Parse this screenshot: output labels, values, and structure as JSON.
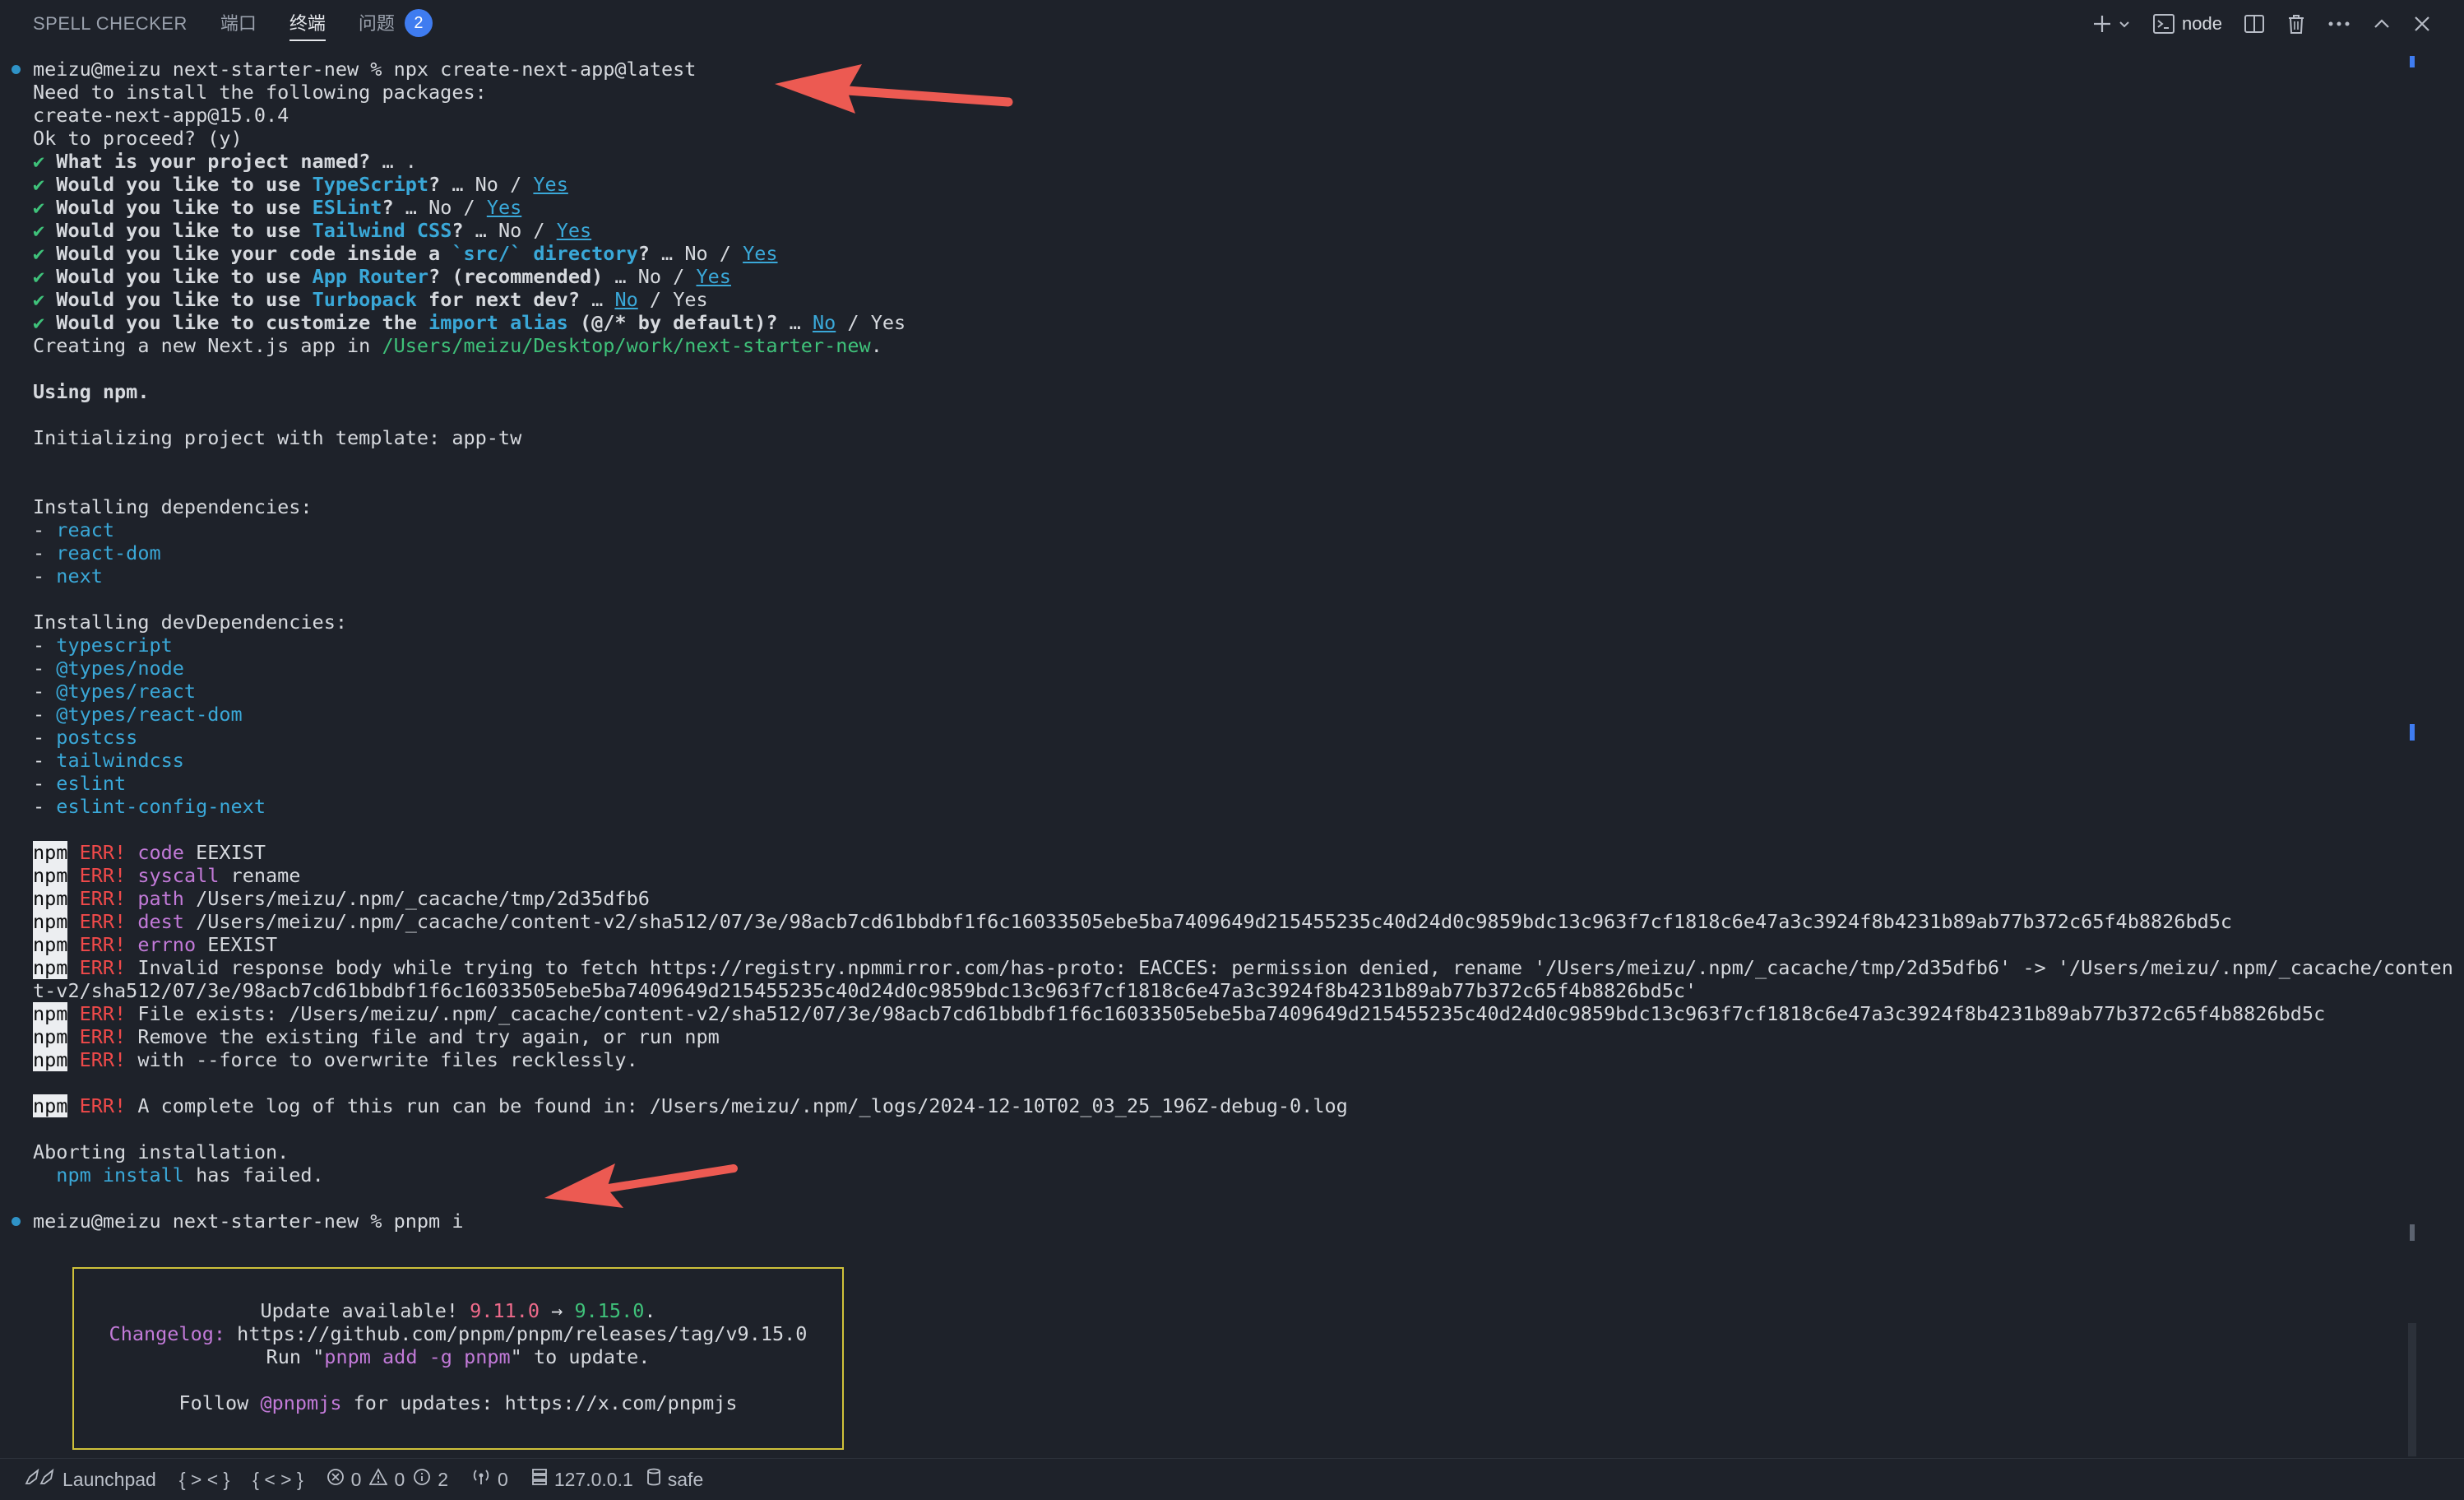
{
  "panel": {
    "tabs": [
      {
        "label": "SPELL CHECKER"
      },
      {
        "label": "端口"
      },
      {
        "label": "终端"
      },
      {
        "label": "问题"
      }
    ],
    "problems_count": "2",
    "terminal_name": "node"
  },
  "terminal": {
    "prompt1": "meizu@meizu next-starter-new % npx create-next-app@latest",
    "l_need": "Need to install the following packages:",
    "l_pkg": "create-next-app@15.0.4",
    "l_ok": "Ok to proceed? (y)",
    "q_name": "What is your project named?",
    "q_name_ans": " … .",
    "q_ts_a": "Would you like to use ",
    "q_ts_b": "TypeScript",
    "q_eslint_b": "ESLint",
    "q_tw_b": "Tailwind CSS",
    "q_src_a": "Would you like your code inside a ",
    "q_src_b": "`src/` directory",
    "q_router_b": "App Router",
    "q_router_c": "? (recommended)",
    "q_turbo_b": "Turbopack",
    "q_turbo_c": " for next dev?",
    "q_alias_a": "Would you like to customize the ",
    "q_alias_b": "import alias",
    "q_alias_c": " (@/* by default)?",
    "ans_sep": " … ",
    "no": "No",
    "slash": " / ",
    "yes": "Yes",
    "creating": "Creating a new Next.js app in ",
    "creating_path": "/Users/meizu/Desktop/work/next-starter-new",
    "using": "Using npm.",
    "init": "Initializing project with template: app-tw",
    "deps_header": "Installing dependencies:",
    "deps": [
      "react",
      "react-dom",
      "next"
    ],
    "devdeps_header": "Installing devDependencies:",
    "devdeps": [
      "typescript",
      "@types/node",
      "@types/react",
      "@types/react-dom",
      "postcss",
      "tailwindcss",
      "eslint",
      "eslint-config-next"
    ],
    "npm": "npm",
    "err": "ERR!",
    "e_code_k": "code",
    "e_code_v": " EEXIST",
    "e_sys_k": "syscall",
    "e_sys_v": " rename",
    "e_path_k": "path",
    "e_path_v": " /Users/meizu/.npm/_cacache/tmp/2d35dfb6",
    "e_dest_k": "dest",
    "e_dest_v": " /Users/meizu/.npm/_cacache/content-v2/sha512/07/3e/98acb7cd61bbdbf1f6c16033505ebe5ba7409649d215455235c40d24d0c9859bdc13c963f7cf1818c6e47a3c3924f8b4231b89ab77b372c65f4b8826bd5c",
    "e_errno_k": "errno",
    "e_errno_v": " EEXIST",
    "e_invalid": " Invalid response body while trying to fetch https://registry.npmmirror.com/has-proto: EACCES: permission denied, rename '/Users/meizu/.npm/_cacache/tmp/2d35dfb6' -> '/Users/meizu/.npm/_cacache/conten",
    "e_invalid_2": "t-v2/sha512/07/3e/98acb7cd61bbdbf1f6c16033505ebe5ba7409649d215455235c40d24d0c9859bdc13c963f7cf1818c6e47a3c3924f8b4231b89ab77b372c65f4b8826bd5c'",
    "e_exists": " File exists: /Users/meizu/.npm/_cacache/content-v2/sha512/07/3e/98acb7cd61bbdbf1f6c16033505ebe5ba7409649d215455235c40d24d0c9859bdc13c963f7cf1818c6e47a3c3924f8b4231b89ab77b372c65f4b8826bd5c",
    "e_remove": " Remove the existing file and try again, or run npm",
    "e_force": " with --force to overwrite files recklessly.",
    "e_log": " A complete log of this run can be found in: /Users/meizu/.npm/_logs/2024-12-10T02_03_25_196Z-debug-0.log",
    "aborting": "Aborting installation.",
    "npm_install": "npm install",
    "has_failed": " has failed.",
    "prompt2": "meizu@meizu next-starter-new % pnpm i",
    "upd_a": "Update available! ",
    "upd_old": "9.11.0",
    "upd_arrow": " → ",
    "upd_new": "9.15.0",
    "upd_dot": ".",
    "changelog_k": "Changelog:",
    "changelog_v": " https://github.com/pnpm/pnpm/releases/tag/v9.15.0",
    "run_a": "Run \"",
    "run_cmd": "pnpm add -g pnpm",
    "run_b": "\" to update.",
    "follow_a": "Follow ",
    "follow_handle": "@pnpmjs",
    "follow_b": " for updates: https://x.com/pnpmjs"
  },
  "statusbar": {
    "launchpad": "Launchpad",
    "braces1": "{ > < }",
    "braces2": "{ < > }",
    "errors": "0",
    "warnings": "0",
    "infos": "2",
    "ports": "0",
    "host": "127.0.0.1",
    "safe": "safe"
  },
  "colors": {
    "background": "#1e222a",
    "accent_blue": "#3f7cf0",
    "cyan": "#3aa8d8",
    "green": "#3fc27a",
    "error_red": "#f04a4a",
    "annotation_arrow": "#ec5a52",
    "update_box_border": "#cfc13a"
  }
}
